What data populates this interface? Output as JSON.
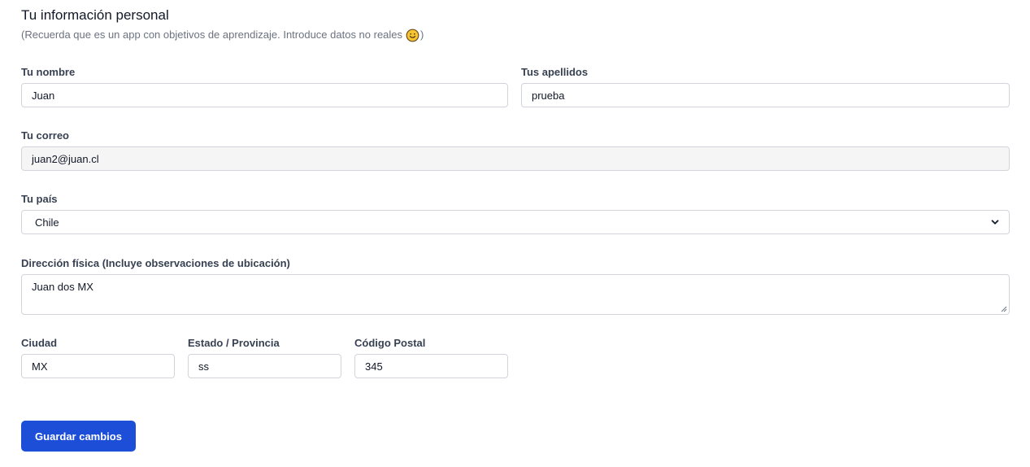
{
  "header": {
    "title": "Tu información personal",
    "subtitle": "(Recuerda que es un app con objetivos de aprendizaje. Introduce datos no reales",
    "subtitle_end": ")",
    "emoji": "smiling-face-icon"
  },
  "form": {
    "first_name": {
      "label": "Tu nombre",
      "value": "Juan"
    },
    "last_name": {
      "label": "Tus apellidos",
      "value": "prueba"
    },
    "email": {
      "label": "Tu correo",
      "value": "juan2@juan.cl"
    },
    "country": {
      "label": "Tu país",
      "value": "Chile"
    },
    "address": {
      "label": "Dirección física (Incluye observaciones de ubicación)",
      "value": "Juan dos MX"
    },
    "city": {
      "label": "Ciudad",
      "value": "MX"
    },
    "state": {
      "label": "Estado / Provincia",
      "value": "ss"
    },
    "postal_code": {
      "label": "Código Postal",
      "value": "345"
    }
  },
  "actions": {
    "save_label": "Guardar cambios"
  },
  "colors": {
    "primary": "#1d4ed8",
    "border": "#d1d5db",
    "readonly_bg": "#f5f5f5",
    "muted_text": "#6b7280"
  }
}
